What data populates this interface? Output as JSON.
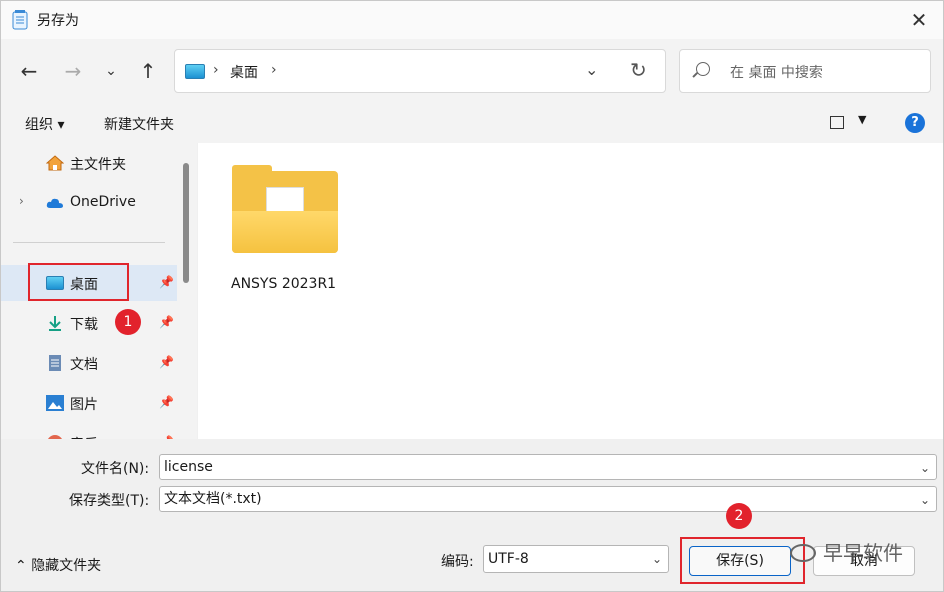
{
  "window": {
    "title": "另存为"
  },
  "nav": {
    "back_icon": "arrow-left-icon",
    "forward_icon": "arrow-right-icon",
    "recent_icon": "chevron-down-icon",
    "up_icon": "arrow-up-icon"
  },
  "address": {
    "sep1": "›",
    "location": "桌面",
    "sep2": "›"
  },
  "search": {
    "placeholder": "在 桌面 中搜索"
  },
  "toolbar": {
    "organize": "组织 ▾",
    "new_folder": "新建文件夹",
    "help": "?"
  },
  "sidebar": {
    "items": [
      {
        "label": "主文件夹",
        "icon": "home-icon"
      },
      {
        "label": "OneDrive",
        "icon": "cloud-icon"
      },
      {
        "label": "桌面",
        "icon": "desktop-icon"
      },
      {
        "label": "下载",
        "icon": "download-icon"
      },
      {
        "label": "文档",
        "icon": "document-icon"
      },
      {
        "label": "图片",
        "icon": "picture-icon"
      },
      {
        "label": "音乐",
        "icon": "music-icon"
      }
    ]
  },
  "content": {
    "folders": [
      {
        "name": "ANSYS 2023R1"
      }
    ]
  },
  "form": {
    "filename_label": "文件名(N):",
    "filename_value": "license",
    "filetype_label": "保存类型(T):",
    "filetype_value": "文本文档(*.txt)",
    "hide_folders": "隐藏文件夹",
    "encoding_label": "编码:",
    "encoding_value": "UTF-8",
    "save": "保存(S)",
    "cancel": "取消"
  },
  "annotations": {
    "step1": "1",
    "step2": "2"
  },
  "watermark": {
    "text": "早早软件"
  },
  "colors": {
    "accent": "#1a73d9",
    "highlight": "#e0252c",
    "folder": "#f4c247"
  }
}
